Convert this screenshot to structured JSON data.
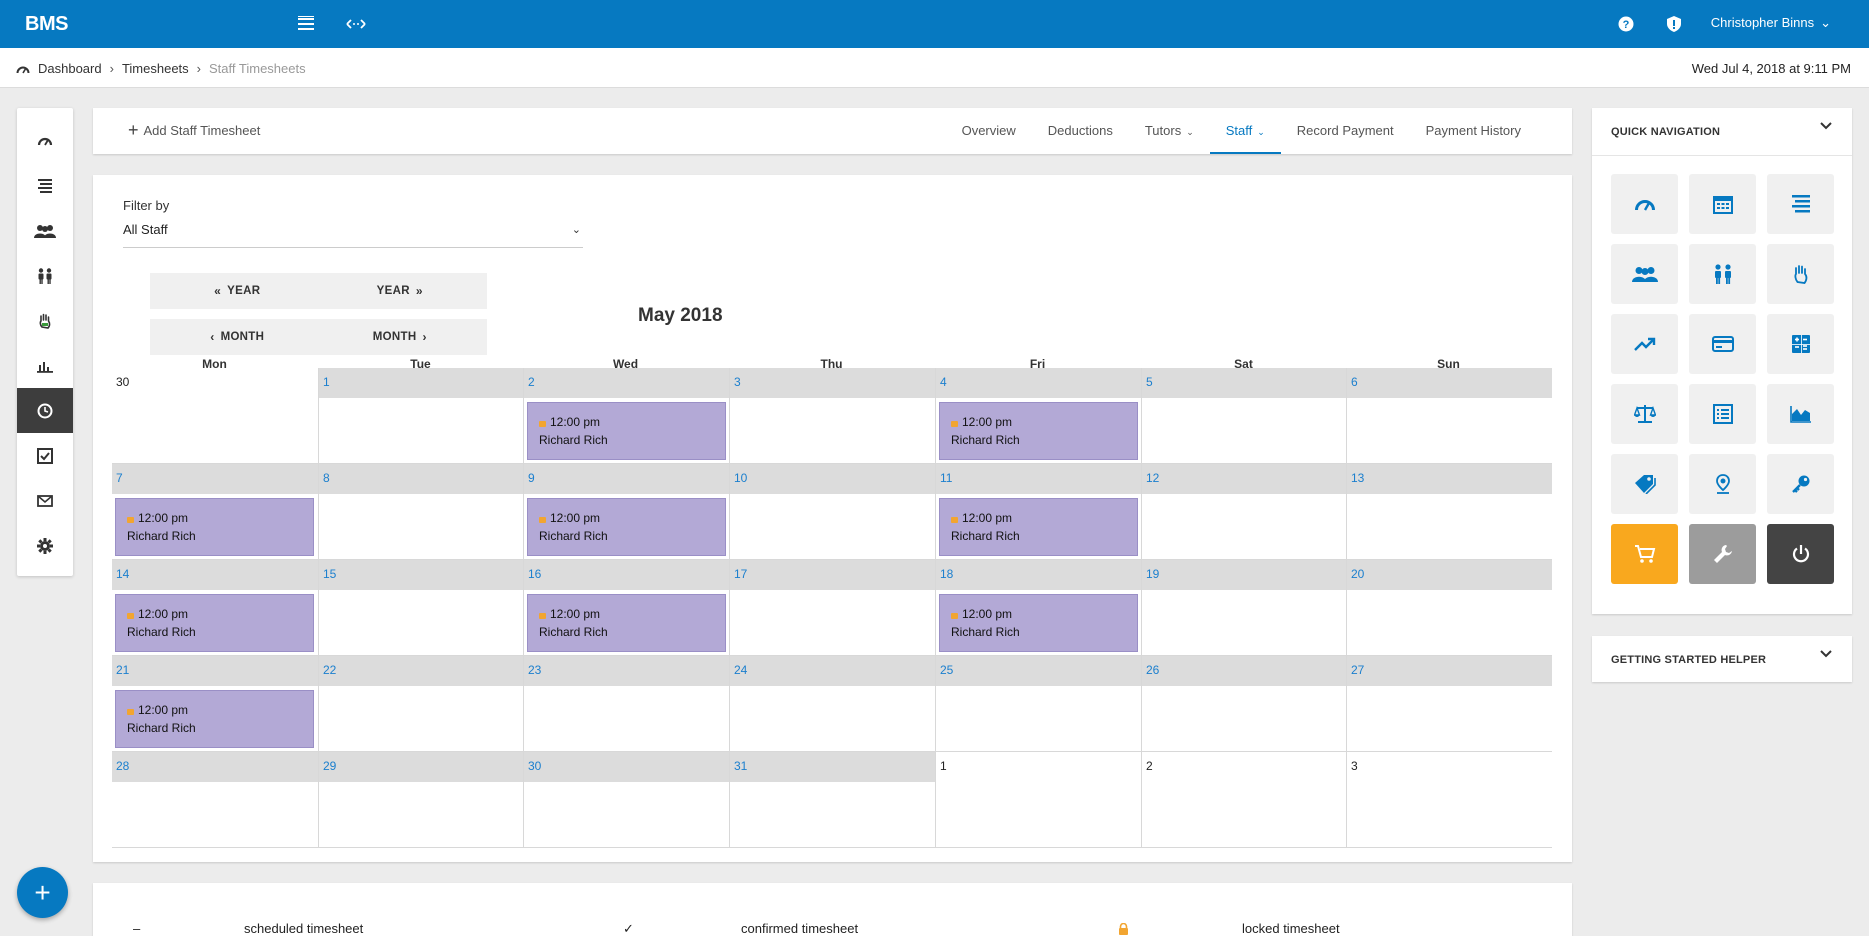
{
  "topbar": {
    "brand": "BMS",
    "user_name": "Christopher Binns"
  },
  "breadcrumb": {
    "items": [
      "Dashboard",
      "Timesheets",
      "Staff Timesheets"
    ],
    "datetime": "Wed Jul 4, 2018 at 9:11 PM"
  },
  "toolbar": {
    "add_label": "Add Staff Timesheet",
    "tabs": [
      {
        "label": "Overview"
      },
      {
        "label": "Deductions"
      },
      {
        "label": "Tutors"
      },
      {
        "label": "Staff"
      },
      {
        "label": "Record Payment"
      },
      {
        "label": "Payment History"
      }
    ]
  },
  "filter": {
    "label": "Filter by",
    "value": "All Staff"
  },
  "calendar_nav": {
    "prev_year": "YEAR",
    "next_year": "YEAR",
    "prev_month": "MONTH",
    "next_month": "MONTH"
  },
  "calendar": {
    "title": "May 2018",
    "weekdays": [
      "Mon",
      "Tue",
      "Wed",
      "Thu",
      "Fri",
      "Sat",
      "Sun"
    ],
    "weeks": [
      [
        {
          "day": "30",
          "other": true,
          "events": []
        },
        {
          "day": "1",
          "other": false,
          "events": []
        },
        {
          "day": "2",
          "other": false,
          "events": [
            {
              "time": "12:00 pm",
              "name": "Richard Rich"
            }
          ]
        },
        {
          "day": "3",
          "other": false,
          "events": []
        },
        {
          "day": "4",
          "other": false,
          "events": [
            {
              "time": "12:00 pm",
              "name": "Richard Rich"
            }
          ]
        },
        {
          "day": "5",
          "other": false,
          "events": []
        },
        {
          "day": "6",
          "other": false,
          "events": []
        }
      ],
      [
        {
          "day": "7",
          "other": false,
          "events": [
            {
              "time": "12:00 pm",
              "name": "Richard Rich"
            }
          ]
        },
        {
          "day": "8",
          "other": false,
          "events": []
        },
        {
          "day": "9",
          "other": false,
          "events": [
            {
              "time": "12:00 pm",
              "name": "Richard Rich"
            }
          ]
        },
        {
          "day": "10",
          "other": false,
          "events": []
        },
        {
          "day": "11",
          "other": false,
          "events": [
            {
              "time": "12:00 pm",
              "name": "Richard Rich"
            }
          ]
        },
        {
          "day": "12",
          "other": false,
          "events": []
        },
        {
          "day": "13",
          "other": false,
          "events": []
        }
      ],
      [
        {
          "day": "14",
          "other": false,
          "events": [
            {
              "time": "12:00 pm",
              "name": "Richard Rich"
            }
          ]
        },
        {
          "day": "15",
          "other": false,
          "events": []
        },
        {
          "day": "16",
          "other": false,
          "events": [
            {
              "time": "12:00 pm",
              "name": "Richard Rich"
            }
          ]
        },
        {
          "day": "17",
          "other": false,
          "events": []
        },
        {
          "day": "18",
          "other": false,
          "events": [
            {
              "time": "12:00 pm",
              "name": "Richard Rich"
            }
          ]
        },
        {
          "day": "19",
          "other": false,
          "events": []
        },
        {
          "day": "20",
          "other": false,
          "events": []
        }
      ],
      [
        {
          "day": "21",
          "other": false,
          "events": [
            {
              "time": "12:00 pm",
              "name": "Richard Rich"
            }
          ]
        },
        {
          "day": "22",
          "other": false,
          "events": []
        },
        {
          "day": "23",
          "other": false,
          "events": []
        },
        {
          "day": "24",
          "other": false,
          "events": []
        },
        {
          "day": "25",
          "other": false,
          "events": []
        },
        {
          "day": "26",
          "other": false,
          "events": []
        },
        {
          "day": "27",
          "other": false,
          "events": []
        }
      ],
      [
        {
          "day": "28",
          "other": false,
          "events": []
        },
        {
          "day": "29",
          "other": false,
          "events": []
        },
        {
          "day": "30",
          "other": false,
          "events": []
        },
        {
          "day": "31",
          "other": false,
          "events": []
        },
        {
          "day": "1",
          "other": true,
          "events": []
        },
        {
          "day": "2",
          "other": true,
          "events": []
        },
        {
          "day": "3",
          "other": true,
          "events": []
        }
      ]
    ]
  },
  "legend": {
    "scheduled_symbol": "–",
    "scheduled_label": "scheduled timesheet",
    "confirmed_symbol": "✓",
    "confirmed_label": "confirmed timesheet",
    "locked_label": "locked timesheet"
  },
  "quick_nav": {
    "title": "QUICK NAVIGATION",
    "tiles": [
      "dashboard-icon",
      "calendar-icon",
      "list-icon",
      "group-icon",
      "pair-icon",
      "hand-icon",
      "trend-icon",
      "credit-card-icon",
      "calculator-icon",
      "scale-icon",
      "table-icon",
      "area-chart-icon",
      "tag-icon",
      "location-icon",
      "key-icon",
      "cart-icon",
      "wrench-icon",
      "power-icon"
    ]
  },
  "helper": {
    "title": "GETTING STARTED HELPER"
  },
  "colors": {
    "primary": "#0679c1",
    "event": "#b3a9d6",
    "lock": "#f2a531",
    "tile_orange": "#f9a81e",
    "tile_gray": "#9c9c9c",
    "tile_dark": "#444444"
  }
}
